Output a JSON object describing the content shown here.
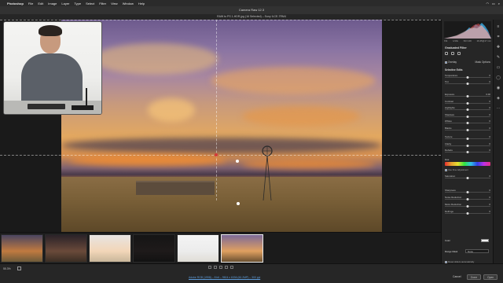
{
  "menubar": {
    "app": "Photoshop",
    "items": [
      "File",
      "Edit",
      "Image",
      "Layer",
      "Type",
      "Select",
      "Filter",
      "View",
      "Window",
      "Help"
    ]
  },
  "window": {
    "title": "Camera Raw 12.3",
    "subtitle": "RAW to PS 1-HDR.jpg (16 Selected)  –  Sony ILCE-7RM4"
  },
  "histogram": {
    "readout": [
      "f/11",
      "1/10s",
      "ISO 100",
      "16-35@17 mm"
    ]
  },
  "panel": {
    "title": "Graduated Filter",
    "overlay_label": "Overlay",
    "mask_label": "Mask Options",
    "section_label": "Selective Edits",
    "sliders_a": [
      {
        "label": "Temperature",
        "value": "0",
        "pos": 0.5
      },
      {
        "label": "Tint",
        "value": "0",
        "pos": 0.5
      }
    ],
    "sliders_b": [
      {
        "label": "Exposure",
        "value": "0.00",
        "pos": 0.5
      },
      {
        "label": "Contrast",
        "value": "0",
        "pos": 0.5
      },
      {
        "label": "Highlights",
        "value": "0",
        "pos": 0.5
      },
      {
        "label": "Shadows",
        "value": "0",
        "pos": 0.5
      },
      {
        "label": "Whites",
        "value": "0",
        "pos": 0.5
      },
      {
        "label": "Blacks",
        "value": "0",
        "pos": 0.5
      }
    ],
    "sliders_c": [
      {
        "label": "Texture",
        "value": "0",
        "pos": 0.5
      },
      {
        "label": "Clarity",
        "value": "0",
        "pos": 0.5
      },
      {
        "label": "Dehaze",
        "value": "0",
        "pos": 0.5
      }
    ],
    "hue_label": "Hue",
    "fine_adjust_label": "Use Fine Adjustment",
    "saturation": {
      "label": "Saturation",
      "value": "0",
      "pos": 0.5
    },
    "sliders_d": [
      {
        "label": "Sharpness",
        "value": "0",
        "pos": 0.5
      },
      {
        "label": "Noise Reduction",
        "value": "0",
        "pos": 0.5
      },
      {
        "label": "Moire Reduction",
        "value": "0",
        "pos": 0.5
      },
      {
        "label": "Defringe",
        "value": "0",
        "pos": 0.5
      }
    ],
    "color_label": "Color",
    "range_mask_label": "Range Mask",
    "range_mask_value": "None",
    "reset_label": "Reset sliders automatically"
  },
  "filmstrip": {
    "thumbnails": [
      {
        "name": "thumb-1",
        "colors": [
          "#4a4560",
          "#c07a40",
          "#6d5a3a"
        ]
      },
      {
        "name": "thumb-2",
        "colors": [
          "#2a2228",
          "#6a4a3a",
          "#3a2e24"
        ]
      },
      {
        "name": "thumb-3",
        "colors": [
          "#e8e4e2",
          "#f2d6b8",
          "#c8b69a"
        ]
      },
      {
        "name": "thumb-4",
        "colors": [
          "#151515",
          "#1e1a1a",
          "#121212"
        ]
      },
      {
        "name": "thumb-5",
        "colors": [
          "#f4f4f4",
          "#ececec",
          "#e0ddd6"
        ]
      },
      {
        "name": "thumb-6",
        "colors": [
          "#7c6a98",
          "#e0a060",
          "#6a5030"
        ],
        "selected": true
      }
    ]
  },
  "bottombar": {
    "zoom": "55.3%",
    "metadata": "Adobe RGB (1998) – 8 bit – 9504 x 6336 (60.2MP) – 300 ppi",
    "cancel_label": "Cancel",
    "done_label": "Done",
    "open_label": "Open"
  },
  "toolbar": {
    "icons": [
      "edit-icon",
      "crop-icon",
      "heal-icon",
      "brush-icon",
      "gradient-icon",
      "radial-icon",
      "redeye-icon",
      "presets-icon",
      "more-icon"
    ]
  }
}
